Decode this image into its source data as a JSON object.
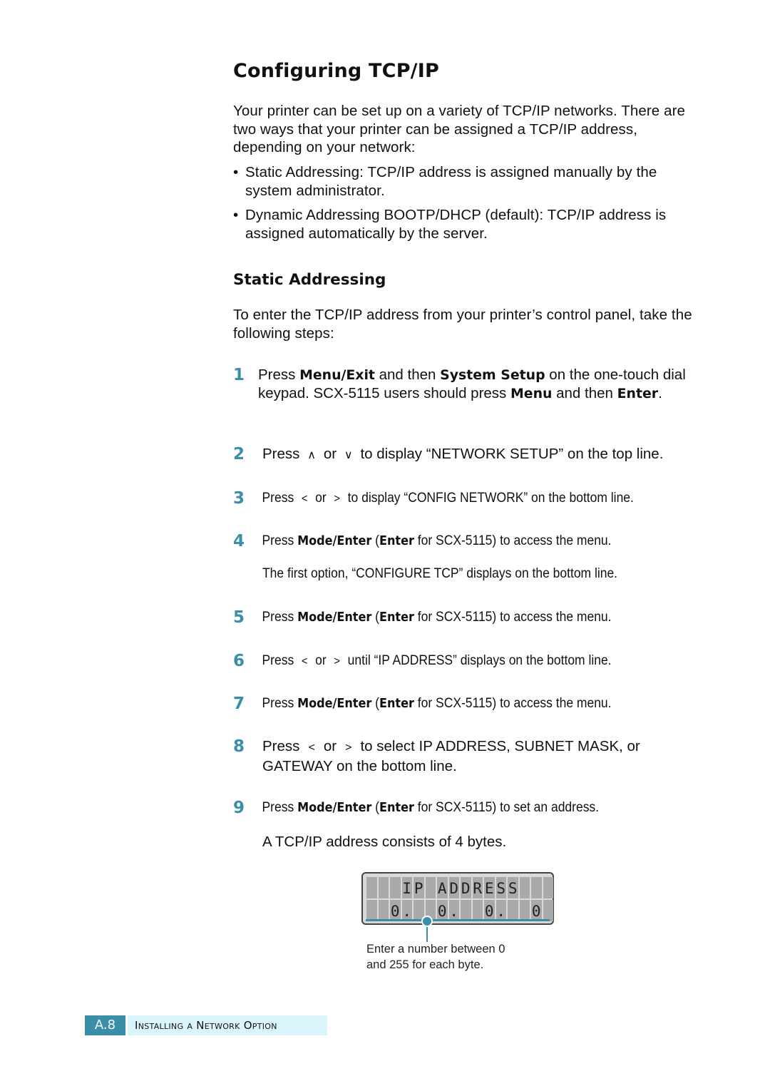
{
  "page": {
    "title": "Configuring TCP/IP",
    "intro": "Your printer can be set up on a variety of TCP/IP networks. There are two ways that your printer can be assigned a TCP/IP address, depending on your network:",
    "bullets": [
      "Static Addressing: TCP/IP address is assigned manually by the system administrator.",
      "Dynamic Addressing BOOTP/DHCP (default): TCP/IP address is assigned automatically by the server."
    ],
    "bullet_glyph": "•",
    "section_title": "Static Addressing",
    "section_intro": "To enter the TCP/IP address from your printer’s control panel, take the following steps:"
  },
  "steps": [
    {
      "num": "1",
      "parts": [
        "Press ",
        "Menu/Exit",
        " and then ",
        "System Setup",
        " on the one-touch dial keypad. SCX-5115 users should press ",
        "Menu",
        " and then ",
        "Enter",
        "."
      ]
    },
    {
      "num": "2",
      "pre": "Press",
      "key1": "up-arrow",
      "key1_glyph": "∧",
      "or": "or",
      "key2": "down-arrow",
      "key2_glyph": "∨",
      "post": "to display “NETWORK SETUP” on the top line."
    },
    {
      "num": "3",
      "pre": "Press",
      "key1": "left-arrow",
      "key1_glyph": "<",
      "or": "or",
      "key2": "right-arrow",
      "key2_glyph": ">",
      "post": "to display “CONFIG NETWORK” on the bottom line."
    },
    {
      "num": "4",
      "parts": [
        "Press ",
        "Mode/Enter",
        " (",
        "Enter",
        " for SCX-5115) to access the menu."
      ],
      "note": "The first option, “CONFIGURE TCP” displays on the bottom line."
    },
    {
      "num": "5",
      "parts": [
        "Press ",
        "Mode/Enter",
        " (",
        "Enter",
        " for SCX-5115) to access the menu."
      ]
    },
    {
      "num": "6",
      "pre": "Press",
      "key1": "left-arrow",
      "key1_glyph": "<",
      "or": "or",
      "key2": "right-arrow",
      "key2_glyph": ">",
      "post": "until “IP ADDRESS” displays on the bottom line."
    },
    {
      "num": "7",
      "parts": [
        "Press ",
        "Mode/Enter",
        " (",
        "Enter",
        " for SCX-5115) to access the menu."
      ]
    },
    {
      "num": "8",
      "pre": "Press",
      "key1": "left-arrow",
      "key1_glyph": "<",
      "or": "or",
      "key2": "right-arrow",
      "key2_glyph": ">",
      "post": "to select IP ADDRESS, SUBNET MASK, or GATEWAY on the bottom line."
    },
    {
      "num": "9",
      "parts": [
        "Press ",
        "Mode/Enter",
        " (",
        "Enter",
        " for SCX-5115) to set an address."
      ],
      "note": "A TCP/IP address consists of 4 bytes."
    }
  ],
  "lcd": {
    "top_line": "   IP ADDRESS   ",
    "bottom_line": "  0.  0.  0.  0 "
  },
  "caption": [
    "Enter a number between 0",
    "and 255 for each byte."
  ],
  "footer": {
    "page_number": "A.8",
    "section": "Installing a Network Option"
  },
  "colors": {
    "accent": "#3a8ea8",
    "footer_label_bg": "#d9f5fb"
  }
}
